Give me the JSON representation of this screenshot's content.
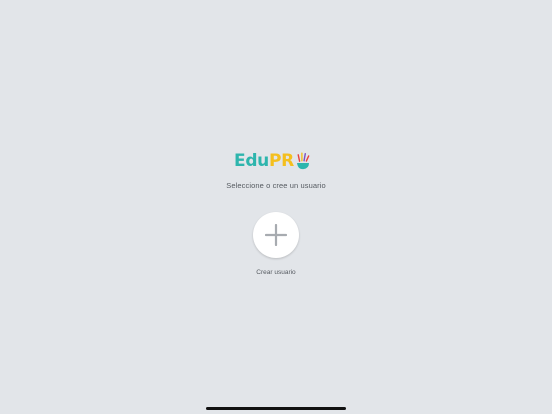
{
  "app": {
    "logo": {
      "part1": "Edu",
      "part2": "PR",
      "icon": "hand-logo-icon"
    },
    "subtitle": "Seleccione o cree un usuario",
    "create_user": {
      "icon": "plus-icon",
      "label": "Crear usuario"
    }
  },
  "colors": {
    "background": "#e2e5e9",
    "logo_edu": "#2db5ad",
    "logo_pr": "#f4bf1e",
    "text": "#555a60"
  }
}
